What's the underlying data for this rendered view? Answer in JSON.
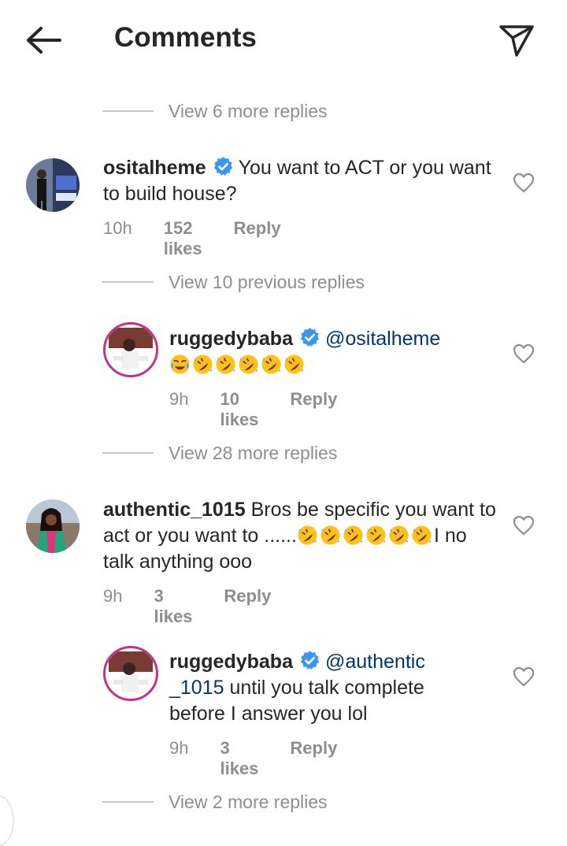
{
  "header": {
    "title": "Comments",
    "back_icon": "arrow-left-icon",
    "share_icon": "paper-plane-icon"
  },
  "view_more": [
    "View 6 more replies",
    "View 10 previous replies",
    "View 28 more replies",
    "View 2 more replies"
  ],
  "comments": [
    {
      "username": "ositalheme",
      "verified": true,
      "text": "You want to ACT or you want to build house?",
      "time": "10h",
      "likes": "152 likes",
      "reply": "Reply"
    },
    {
      "username": "ruggedybaba",
      "verified": true,
      "mention": "@ositalheme",
      "emojis": [
        "face-with-tears-of-joy",
        "rolling-on-floor-laughing",
        "rolling-on-floor-laughing",
        "rolling-on-floor-laughing",
        "rolling-on-floor-laughing",
        "rolling-on-floor-laughing"
      ],
      "time": "9h",
      "likes": "10 likes",
      "reply": "Reply"
    },
    {
      "username": "authentic_1015",
      "verified": false,
      "text_part1": "Bros be specific you want to act or you want to ......",
      "text_part2": "I no talk anything ooo",
      "emojis_inline": [
        "rolling-on-floor-laughing",
        "rolling-on-floor-laughing",
        "rolling-on-floor-laughing"
      ],
      "emojis_line3": [
        "rolling-on-floor-laughing",
        "rolling-on-floor-laughing",
        "rolling-on-floor-laughing"
      ],
      "time": "9h",
      "likes": "3 likes",
      "reply": "Reply"
    },
    {
      "username": "ruggedybaba",
      "verified": true,
      "mention_part1": "@authentic",
      "mention_part2": "_1015",
      "text": " until you talk complete before I answer you lol",
      "time": "9h",
      "likes": "3 likes",
      "reply": "Reply"
    }
  ],
  "colors": {
    "accent_verified": "#3897f0",
    "mention": "#00376b",
    "muted": "#8e8e8e",
    "story_ring": "#c13584"
  }
}
